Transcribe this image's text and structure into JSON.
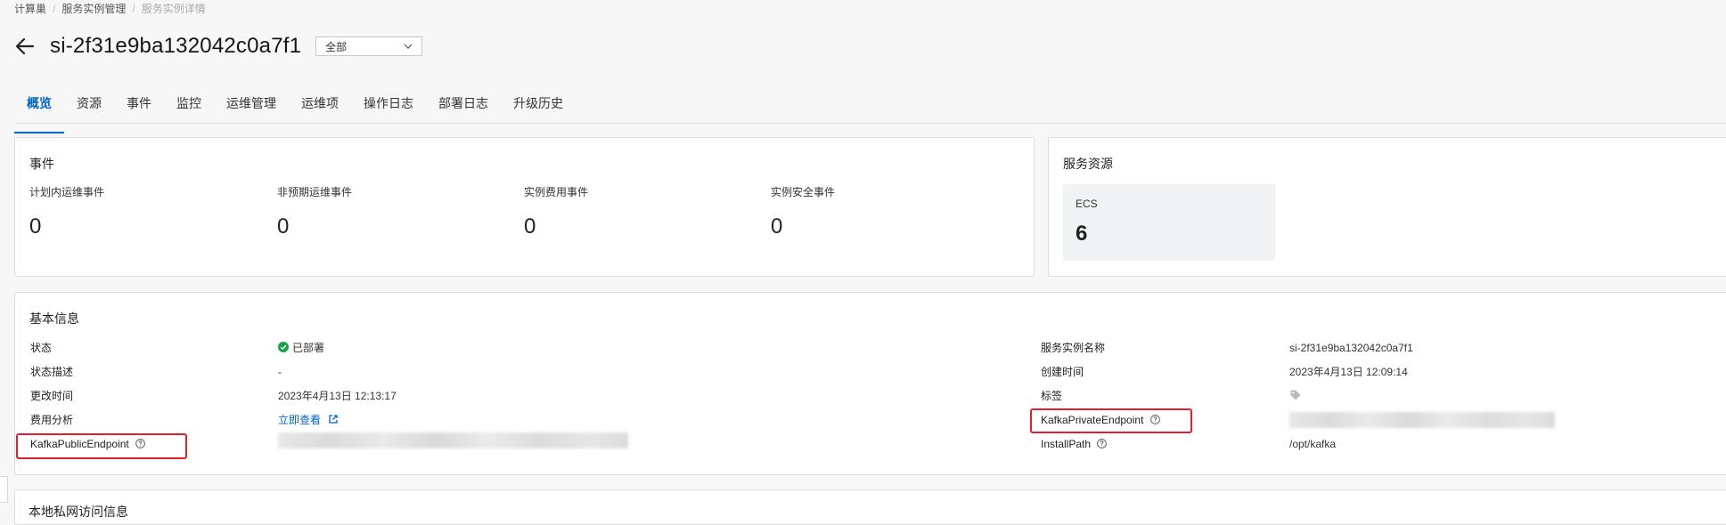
{
  "breadcrumb": [
    "计算巢",
    "服务实例管理",
    "服务实例详情"
  ],
  "page": {
    "title": "si-2f31e9ba132042c0a7f1",
    "filter_value": "全部"
  },
  "tabs": [
    "概览",
    "资源",
    "事件",
    "监控",
    "运维管理",
    "运维项",
    "操作日志",
    "部署日志",
    "升级历史"
  ],
  "events": {
    "title": "事件",
    "items": [
      {
        "label": "计划内运维事件",
        "value": "0"
      },
      {
        "label": "非预期运维事件",
        "value": "0"
      },
      {
        "label": "实例费用事件",
        "value": "0"
      },
      {
        "label": "实例安全事件",
        "value": "0"
      }
    ]
  },
  "resources": {
    "title": "服务资源",
    "ecs_label": "ECS",
    "ecs_value": "6"
  },
  "basic": {
    "title": "基本信息",
    "left": [
      {
        "label": "状态",
        "value": "已部署"
      },
      {
        "label": "状态描述",
        "value": "-"
      },
      {
        "label": "更改时间",
        "value": "2023年4月13日 12:13:17"
      },
      {
        "label": "费用分析",
        "value": "立即查看"
      },
      {
        "label": "KafkaPublicEndpoint",
        "value": ""
      }
    ],
    "right": [
      {
        "label": "服务实例名称",
        "value": "si-2f31e9ba132042c0a7f1"
      },
      {
        "label": "创建时间",
        "value": "2023年4月13日 12:09:14"
      },
      {
        "label": "标签",
        "value": ""
      },
      {
        "label": "KafkaPrivateEndpoint",
        "value": ""
      },
      {
        "label": "InstallPath",
        "value": "/opt/kafka"
      }
    ]
  },
  "next_section_title": "本地私网访问信息",
  "colors": {
    "accent": "#0064c8",
    "success": "#1ba34a",
    "highlight": "#e0202a"
  }
}
